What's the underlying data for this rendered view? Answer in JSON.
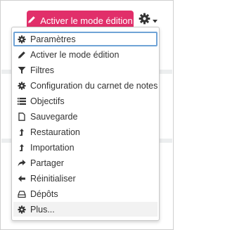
{
  "colors": {
    "accent": "#e12f6a",
    "focus_ring": "#6fa3d6",
    "text": "#333333",
    "icon": "#333333"
  },
  "header": {
    "edit_button": {
      "label": "Activer le mode édition",
      "icon": "pencil-icon"
    },
    "settings_toggle": {
      "icon": "gear-icon",
      "caret": "chevron-down-icon"
    }
  },
  "menu": {
    "items": [
      {
        "label": "Paramètres",
        "icon": "gear-icon"
      },
      {
        "label": "Activer le mode édition",
        "icon": "pencil-icon"
      },
      {
        "label": "Filtres",
        "icon": "filter-icon"
      },
      {
        "label": "Configuration du carnet de notes",
        "icon": "gear-icon"
      },
      {
        "label": "Objectifs",
        "icon": "list-icon"
      },
      {
        "label": "Sauvegarde",
        "icon": "file-icon"
      },
      {
        "label": "Restauration",
        "icon": "level-up-icon"
      },
      {
        "label": "Importation",
        "icon": "level-up-icon"
      },
      {
        "label": "Partager",
        "icon": "share-icon"
      },
      {
        "label": "Réinitialiser",
        "icon": "arrow-left-icon"
      },
      {
        "label": "Dépôts",
        "icon": "hdd-icon"
      },
      {
        "label": "Plus...",
        "icon": "gear-icon"
      }
    ]
  }
}
